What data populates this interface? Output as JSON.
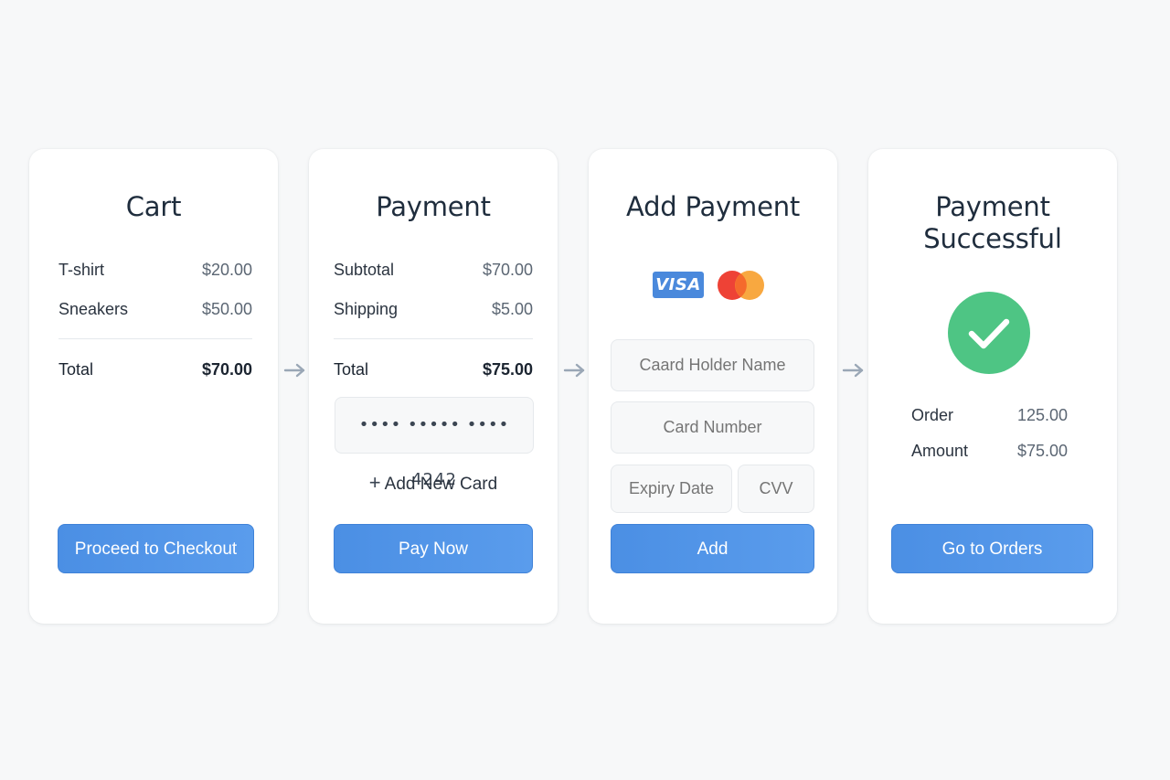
{
  "cart": {
    "title": "Cart",
    "items": [
      {
        "label": "T-shirt",
        "price": "$20.00"
      },
      {
        "label": "Sneakers",
        "price": "$50.00"
      }
    ],
    "total_label": "Total",
    "total_value": "$70.00",
    "button_label": "Proceed to Checkout"
  },
  "payment": {
    "title": "Payment",
    "rows": [
      {
        "label": "Subtotal",
        "value": "$70.00"
      },
      {
        "label": "Shipping",
        "value": "$5.00"
      }
    ],
    "total_label": "Total",
    "total_value": "$75.00",
    "saved_card": "•••• ••••• •••• 4242",
    "add_card_label": "Add New Card",
    "button_label": "Pay Now"
  },
  "add_payment": {
    "title": "Add Payment",
    "brand_visa": "VISA",
    "cardholder_placeholder": "Caard Holder Name",
    "card_number_placeholder": "Card Number",
    "expiry_placeholder": "Expiry Date",
    "cvv_placeholder": "CVV",
    "button_label": "Add"
  },
  "success": {
    "title_line1": "Payment",
    "title_line2": "Successful",
    "order_label": "Order",
    "order_value": "125.00",
    "amount_label": "Amount",
    "amount_value": "$75.00",
    "button_label": "Go to Orders"
  },
  "icons": {
    "flow_arrow": "arrow-right-icon",
    "success": "checkmark-icon",
    "plus": "plus-icon"
  },
  "colors": {
    "accent": "#4b8fe4",
    "success": "#4ec584",
    "visa": "#4a89dc",
    "mc_red": "#ee4236",
    "mc_orange": "#f7a130"
  }
}
